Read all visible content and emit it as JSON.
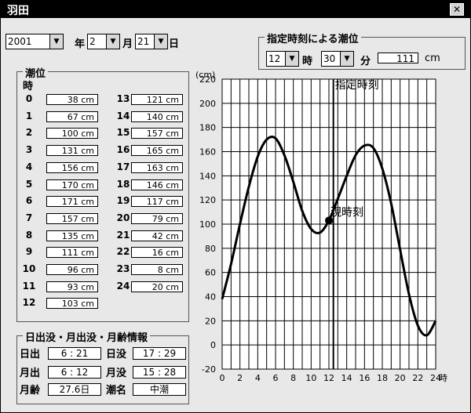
{
  "window": {
    "title": "羽田",
    "close_symbol": "✕"
  },
  "date": {
    "year": "2001",
    "year_label": "年",
    "month": "2",
    "month_label": "月",
    "day": "21",
    "day_label": "日"
  },
  "specified_time": {
    "group_label": "指定時刻による潮位",
    "hour": "12",
    "hour_label": "時",
    "minute": "30",
    "minute_label": "分",
    "level": "111",
    "unit": "cm"
  },
  "tide_table": {
    "group_label": "潮位",
    "hour_header": "時",
    "rows": [
      {
        "hour": "0",
        "level": "38 cm"
      },
      {
        "hour": "1",
        "level": "67 cm"
      },
      {
        "hour": "2",
        "level": "100 cm"
      },
      {
        "hour": "3",
        "level": "131 cm"
      },
      {
        "hour": "4",
        "level": "156 cm"
      },
      {
        "hour": "5",
        "level": "170 cm"
      },
      {
        "hour": "6",
        "level": "171 cm"
      },
      {
        "hour": "7",
        "level": "157 cm"
      },
      {
        "hour": "8",
        "level": "135 cm"
      },
      {
        "hour": "9",
        "level": "111 cm"
      },
      {
        "hour": "10",
        "level": "96 cm"
      },
      {
        "hour": "11",
        "level": "93 cm"
      },
      {
        "hour": "12",
        "level": "103 cm"
      },
      {
        "hour": "13",
        "level": "121 cm"
      },
      {
        "hour": "14",
        "level": "140 cm"
      },
      {
        "hour": "15",
        "level": "157 cm"
      },
      {
        "hour": "16",
        "level": "165 cm"
      },
      {
        "hour": "17",
        "level": "163 cm"
      },
      {
        "hour": "18",
        "level": "146 cm"
      },
      {
        "hour": "19",
        "level": "117 cm"
      },
      {
        "hour": "20",
        "level": "79 cm"
      },
      {
        "hour": "21",
        "level": "42 cm"
      },
      {
        "hour": "22",
        "level": "16 cm"
      },
      {
        "hour": "23",
        "level": "8 cm"
      },
      {
        "hour": "24",
        "level": "20 cm"
      }
    ]
  },
  "sun_moon": {
    "group_label": "日出没・月出没・月齢情報",
    "sunrise_label": "日出",
    "sunrise": "6 : 21",
    "sunset_label": "日没",
    "sunset": "17 : 29",
    "moonrise_label": "月出",
    "moonrise": "6 : 12",
    "moonset_label": "月没",
    "moonset": "15 : 28",
    "moon_age_label": "月齢",
    "moon_age": "27.6日",
    "tide_name_label": "潮名",
    "tide_name": "中潮"
  },
  "chart_data": {
    "type": "line",
    "ylabel": "(cm)",
    "xlabel": "時",
    "xlim": [
      0,
      24
    ],
    "ylim": [
      -20,
      220
    ],
    "grid": true,
    "x_ticks": [
      0,
      2,
      4,
      6,
      8,
      10,
      12,
      14,
      16,
      18,
      20,
      22,
      24
    ],
    "y_ticks": [
      -20,
      0,
      20,
      40,
      60,
      80,
      100,
      120,
      140,
      160,
      180,
      200,
      220
    ],
    "series": [
      {
        "x": [
          0,
          1,
          2,
          3,
          4,
          5,
          6,
          7,
          8,
          9,
          10,
          11,
          12,
          13,
          14,
          15,
          16,
          17,
          18,
          19,
          20,
          21,
          22,
          23,
          24
        ],
        "values": [
          38,
          67,
          100,
          131,
          156,
          170,
          171,
          157,
          135,
          111,
          96,
          93,
          103,
          121,
          140,
          157,
          165,
          163,
          146,
          117,
          79,
          42,
          16,
          8,
          20
        ]
      }
    ],
    "marker_line_label": "指定時刻",
    "marker_line_x": 12.5,
    "current_point_label": "現時刻",
    "current_point": {
      "x": 12.0,
      "y": 103
    },
    "colors": {
      "line": "#000000",
      "grid": "#000000",
      "background": "#ffffff"
    }
  }
}
